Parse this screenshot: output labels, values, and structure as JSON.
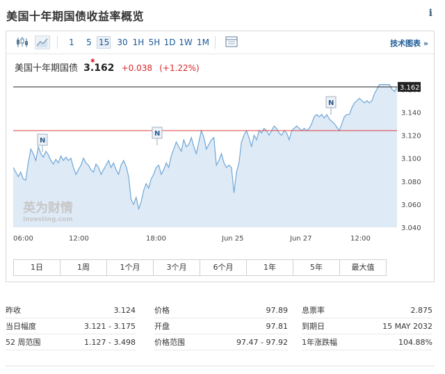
{
  "page": {
    "title": "美国十年期国债收益率概览",
    "info_label": "i"
  },
  "toolbar": {
    "timeframes": [
      "1",
      "5",
      "15",
      "30",
      "1H",
      "5H",
      "1D",
      "1W",
      "1M"
    ],
    "active_timeframe": "15",
    "tech_chart_label": "技术图表 »"
  },
  "quote": {
    "name": "美国十年期国债",
    "price": "3.162",
    "change": "+0.038",
    "change_pct": "(+1.22%)"
  },
  "chart_data": {
    "type": "line",
    "title": "",
    "x_labels": [
      "06:00",
      "12:00",
      "18:00",
      "Jun 25",
      "Jun 27",
      "12:00"
    ],
    "y_ticks": [
      "3.160",
      "3.140",
      "3.120",
      "3.100",
      "3.080",
      "3.060",
      "3.040"
    ],
    "ylim": [
      3.04,
      3.168
    ],
    "last_value_label": "3.162",
    "reference_line": {
      "value": 3.124,
      "color": "#e03a3a"
    },
    "current_line": {
      "value": 3.162,
      "color": "#222222"
    },
    "news_markers": [
      "N",
      "N",
      "N"
    ],
    "series": [
      {
        "values": [
          3.092,
          3.088,
          3.084,
          3.088,
          3.082,
          3.081,
          3.096,
          3.108,
          3.104,
          3.098,
          3.11,
          3.104,
          3.101,
          3.106,
          3.103,
          3.098,
          3.095,
          3.099,
          3.096,
          3.102,
          3.098,
          3.101,
          3.098,
          3.1,
          3.092,
          3.086,
          3.09,
          3.094,
          3.1,
          3.096,
          3.094,
          3.09,
          3.088,
          3.095,
          3.092,
          3.086,
          3.09,
          3.094,
          3.098,
          3.092,
          3.096,
          3.09,
          3.086,
          3.094,
          3.098,
          3.093,
          3.084,
          3.064,
          3.06,
          3.066,
          3.056,
          3.062,
          3.072,
          3.078,
          3.074,
          3.082,
          3.086,
          3.092,
          3.094,
          3.086,
          3.09,
          3.096,
          3.092,
          3.102,
          3.108,
          3.114,
          3.11,
          3.106,
          3.116,
          3.11,
          3.112,
          3.118,
          3.11,
          3.104,
          3.114,
          3.124,
          3.118,
          3.108,
          3.112,
          3.116,
          3.118,
          3.094,
          3.098,
          3.104,
          3.096,
          3.092,
          3.094,
          3.092,
          3.07,
          3.088,
          3.096,
          3.114,
          3.12,
          3.124,
          3.118,
          3.11,
          3.12,
          3.116,
          3.124,
          3.122,
          3.126,
          3.124,
          3.12,
          3.124,
          3.128,
          3.126,
          3.122,
          3.12,
          3.124,
          3.122,
          3.116,
          3.124,
          3.126,
          3.128,
          3.126,
          3.124,
          3.126,
          3.124,
          3.126,
          3.13,
          3.136,
          3.138,
          3.136,
          3.138,
          3.135,
          3.138,
          3.134,
          3.132,
          3.13,
          3.127,
          3.124,
          3.13,
          3.136,
          3.138,
          3.138,
          3.144,
          3.148,
          3.15,
          3.152,
          3.15,
          3.148,
          3.15,
          3.148,
          3.15,
          3.156,
          3.16,
          3.164,
          3.164,
          3.164,
          3.164,
          3.164,
          3.16,
          3.158,
          3.162
        ]
      }
    ]
  },
  "ranges": [
    "1日",
    "1周",
    "1个月",
    "3个月",
    "6个月",
    "1年",
    "5年",
    "最大值"
  ],
  "stats": {
    "col1": [
      {
        "label": "昨收",
        "value": "3.124"
      },
      {
        "label": "当日幅度",
        "value": "3.121 - 3.175"
      },
      {
        "label": "52 周范围",
        "value": "1.127 - 3.498"
      }
    ],
    "col2": [
      {
        "label": "价格",
        "value": "97.89"
      },
      {
        "label": "开盘",
        "value": "97.81"
      },
      {
        "label": "价格范围",
        "value": "97.47 - 97.92"
      }
    ],
    "col3": [
      {
        "label": "息票率",
        "value": "2.875"
      },
      {
        "label": "到期日",
        "value": "15 MAY 2032"
      },
      {
        "label": "1年涨跌幅",
        "value": "104.88%"
      }
    ]
  },
  "watermark": {
    "cn": "英为财情",
    "en": "Investing.com"
  },
  "colors": {
    "line": "#6fa6d6",
    "area_fill": "#deeaf6",
    "up_text": "#d8262a",
    "link": "#1a5a96"
  }
}
